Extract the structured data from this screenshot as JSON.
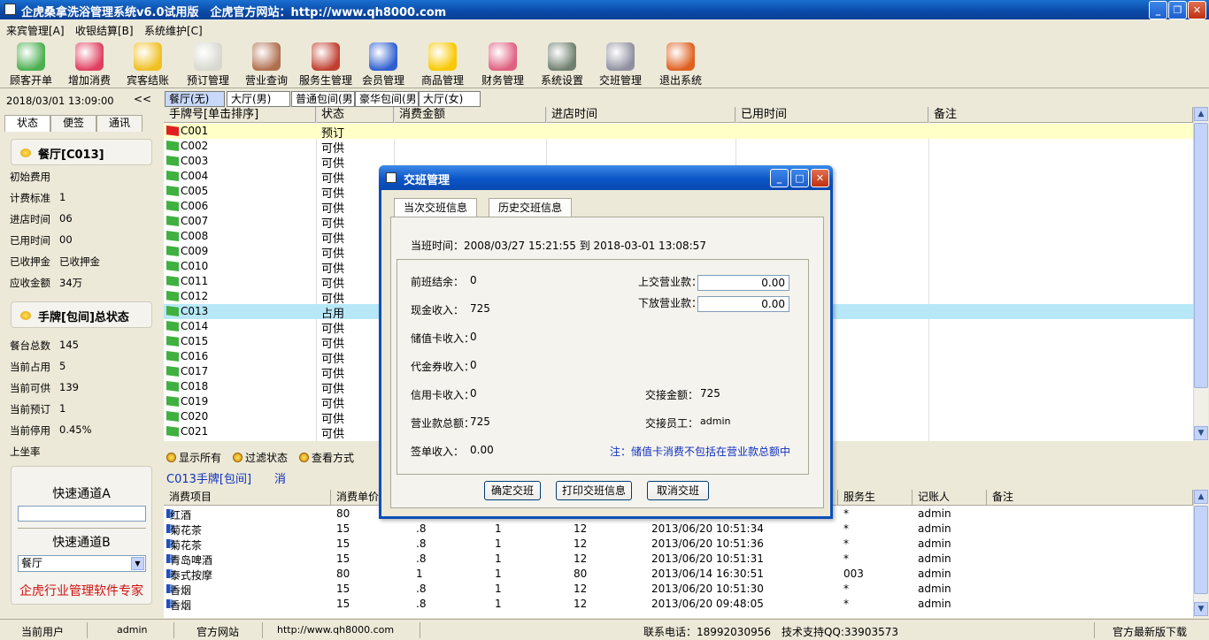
{
  "window": {
    "title": "企虎桑拿洗浴管理系统v6.0试用版　企虎官方网站：http://www.qh8000.com"
  },
  "menu": [
    "来宾管理[A]",
    "收银结算[B]",
    "系统维护[C]"
  ],
  "toolbar": [
    {
      "label": "顾客开单",
      "icon": "customer-icon",
      "color": "#4caf50"
    },
    {
      "label": "增加消费",
      "icon": "add-consume-icon",
      "color": "#e04060"
    },
    {
      "label": "宾客结账",
      "icon": "checkout-icon",
      "color": "#f0c020"
    },
    {
      "label": "预订管理",
      "icon": "alarm-clock-icon",
      "color": "#d8d8d0"
    },
    {
      "label": "营业查询",
      "icon": "query-icon",
      "color": "#b07050"
    },
    {
      "label": "服务生管理",
      "icon": "staff-icon",
      "color": "#c04030"
    },
    {
      "label": "会员管理",
      "icon": "member-icon",
      "color": "#3060d0"
    },
    {
      "label": "商品管理",
      "icon": "star-icon",
      "color": "#f8c800"
    },
    {
      "label": "财务管理",
      "icon": "finance-icon",
      "color": "#e06080"
    },
    {
      "label": "系统设置",
      "icon": "settings-icon",
      "color": "#708070"
    },
    {
      "label": "交班管理",
      "icon": "handshake-icon",
      "color": "#9090a0"
    },
    {
      "label": "退出系统",
      "icon": "exit-icon",
      "color": "#e06020"
    }
  ],
  "left": {
    "datetime": "2018/03/01 13:09:00",
    "collapse": "<<",
    "tabs": [
      "状态",
      "便签",
      "通讯"
    ],
    "section1": "餐厅[C013]",
    "rows1": [
      {
        "label": "初始费用",
        "value": ""
      },
      {
        "label": "计费标准",
        "value": "1"
      },
      {
        "label": "进店时间",
        "value": "06"
      },
      {
        "label": "已用时间",
        "value": "00"
      },
      {
        "label": "已收押金",
        "value": "已收押金"
      },
      {
        "label": "应收金额",
        "value": "34万"
      }
    ],
    "section2": "手牌[包间]总状态",
    "rows2": [
      {
        "label": "餐台总数",
        "value": "145"
      },
      {
        "label": "当前占用",
        "value": "5"
      },
      {
        "label": "当前可供",
        "value": "139"
      },
      {
        "label": "当前预订",
        "value": "1"
      },
      {
        "label": "当前停用",
        "value": "0.45%"
      },
      {
        "label": "上坐率",
        "value": ""
      }
    ],
    "quick_a": "快速通道A",
    "quick_a_value": "",
    "quick_b": "快速通道B",
    "quick_b_value": "餐厅",
    "slogan": "企虎行业管理软件专家"
  },
  "area_tabs": [
    "餐厅(无)",
    "大厅(男)",
    "普通包间(男)",
    "豪华包间(男)",
    "大厅(女)"
  ],
  "grid1": {
    "headers": [
      "手牌号[单击排序]",
      "状态",
      "消费金额",
      "进店时间",
      "已用时间",
      "备注"
    ],
    "rows": [
      {
        "id": "C001",
        "status": "预订",
        "flag": "red"
      },
      {
        "id": "C002",
        "status": "可供",
        "flag": "green"
      },
      {
        "id": "C003",
        "status": "可供",
        "flag": "green"
      },
      {
        "id": "C004",
        "status": "可供",
        "flag": "green"
      },
      {
        "id": "C005",
        "status": "可供",
        "flag": "green"
      },
      {
        "id": "C006",
        "status": "可供",
        "flag": "green"
      },
      {
        "id": "C007",
        "status": "可供",
        "flag": "green"
      },
      {
        "id": "C008",
        "status": "可供",
        "flag": "green"
      },
      {
        "id": "C009",
        "status": "可供",
        "flag": "green"
      },
      {
        "id": "C010",
        "status": "可供",
        "flag": "green"
      },
      {
        "id": "C011",
        "status": "可供",
        "flag": "green"
      },
      {
        "id": "C012",
        "status": "可供",
        "flag": "green"
      },
      {
        "id": "C013",
        "status": "占用",
        "flag": "green"
      },
      {
        "id": "C014",
        "status": "可供",
        "flag": "green"
      },
      {
        "id": "C015",
        "status": "可供",
        "flag": "green"
      },
      {
        "id": "C016",
        "status": "可供",
        "flag": "green"
      },
      {
        "id": "C017",
        "status": "可供",
        "flag": "green"
      },
      {
        "id": "C018",
        "status": "可供",
        "flag": "green"
      },
      {
        "id": "C019",
        "status": "可供",
        "flag": "green"
      },
      {
        "id": "C020",
        "status": "可供",
        "flag": "green"
      },
      {
        "id": "C021",
        "status": "可供",
        "flag": "green"
      }
    ]
  },
  "filters": [
    "显示所有",
    "过滤状态",
    "查看方式"
  ],
  "hand_info": "C013手牌[包间]　　消",
  "grid2": {
    "headers": [
      "消费项目",
      "消费单价",
      "",
      "",
      "",
      "",
      "服务生",
      "记账人",
      "备注"
    ],
    "rows": [
      {
        "item": "红酒",
        "price": "80",
        "disc": "",
        "qty": "",
        "amount": "",
        "time": "",
        "waiter": "*",
        "clerk": "admin"
      },
      {
        "item": "菊花茶",
        "price": "15",
        ".8": "",
        "disc": ".8",
        "qty": "1",
        "amount": "12",
        "time": "2013/06/20 10:51:34",
        "waiter": "*",
        "clerk": "admin"
      },
      {
        "item": "菊花茶",
        "price": "15",
        "disc": ".8",
        "qty": "1",
        "amount": "12",
        "time": "2013/06/20 10:51:36",
        "waiter": "*",
        "clerk": "admin"
      },
      {
        "item": "青岛啤酒",
        "price": "15",
        "disc": ".8",
        "qty": "1",
        "amount": "12",
        "time": "2013/06/20 10:51:31",
        "waiter": "*",
        "clerk": "admin"
      },
      {
        "item": "泰式按摩",
        "price": "80",
        "disc": "1",
        "qty": "1",
        "amount": "80",
        "time": "2013/06/14 16:30:51",
        "waiter": "003",
        "clerk": "admin"
      },
      {
        "item": "香烟",
        "price": "15",
        "disc": ".8",
        "qty": "1",
        "amount": "12",
        "time": "2013/06/20 10:51:30",
        "waiter": "*",
        "clerk": "admin"
      },
      {
        "item": "香烟",
        "price": "15",
        "disc": ".8",
        "qty": "1",
        "amount": "12",
        "time": "2013/06/20 09:48:05",
        "waiter": "*",
        "clerk": "admin"
      }
    ]
  },
  "statusbar": {
    "user_label": "当前用户",
    "user": "admin",
    "site_label": "官方网站",
    "site": "http://www.qh8000.com",
    "phone": "联系电话：18992030956　技术支持QQ:33903573",
    "download": "官方最新版下载"
  },
  "dialog": {
    "title": "交班管理",
    "tabs": [
      "当次交班信息",
      "历史交班信息"
    ],
    "period": "当班时间：2008/03/27 15:21:55 到 2018-03-01 13:08:57",
    "prev_balance_label": "前班结余：",
    "prev_balance": "0",
    "cash_label": "现金收入：",
    "cash": "725",
    "stored_label": "储值卡收入：",
    "stored": "0",
    "voucher_label": "代金券收入：",
    "voucher": "0",
    "credit_label": "信用卡收入：",
    "credit": "0",
    "total_label": "营业款总额：",
    "total": "725",
    "sign_label": "签单收入：",
    "sign": "0.00",
    "handover_amount_label": "上交营业款：",
    "handover_amount": "0.00",
    "leave_amount_label": "下放营业款：",
    "leave_amount": "0.00",
    "transfer_label": "交接金额：",
    "transfer": "725",
    "staff_label": "交接员工：",
    "staff": "admin",
    "note": "注：储值卡消费不包括在营业款总额中",
    "btn_confirm": "确定交班",
    "btn_print": "打印交班信息",
    "btn_cancel": "取消交班"
  }
}
